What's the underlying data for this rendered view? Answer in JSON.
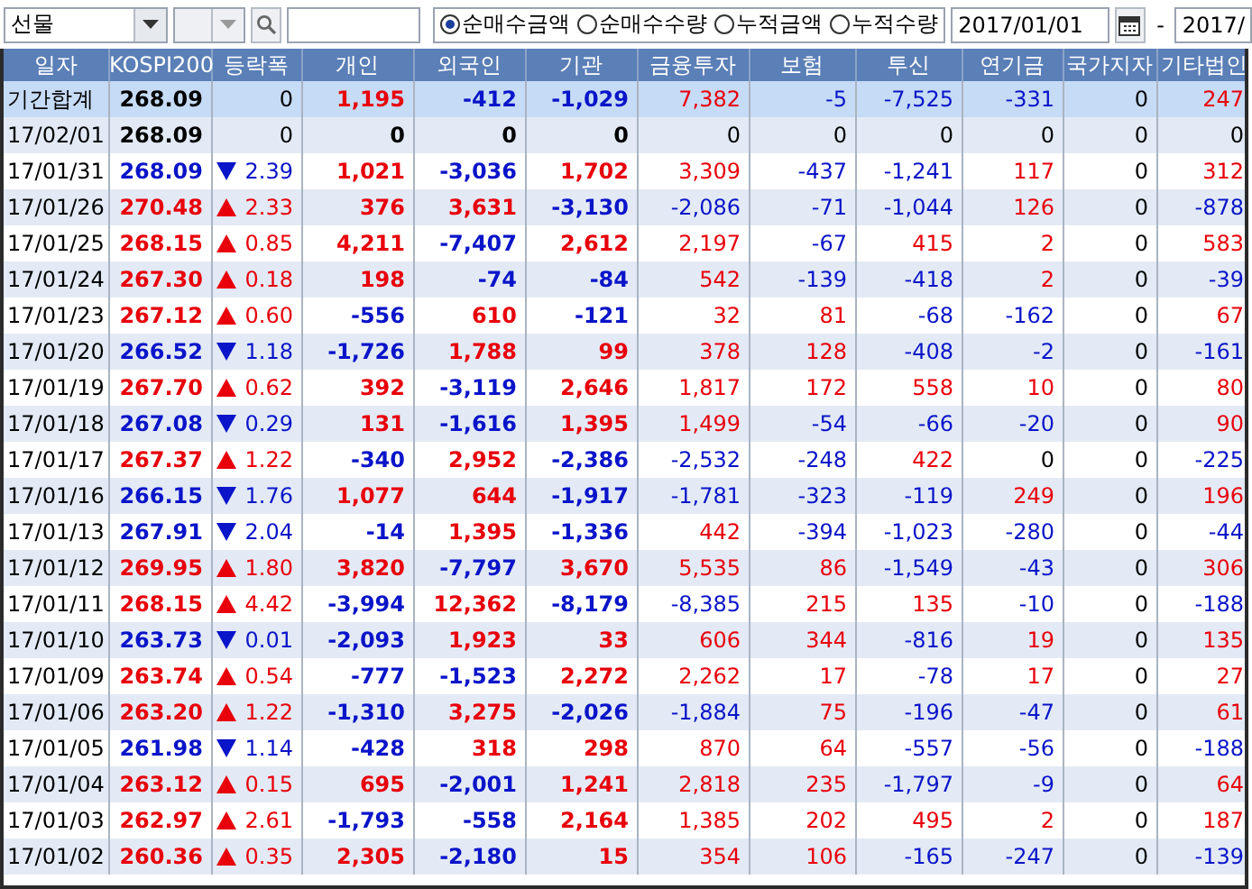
{
  "toolbar": {
    "market_select": {
      "value": "선물"
    },
    "code_select": {
      "disabled": true
    },
    "radio_options": [
      {
        "label": "순매수금액",
        "selected": true
      },
      {
        "label": "순매수수량",
        "selected": false
      },
      {
        "label": "누적금액",
        "selected": false
      },
      {
        "label": "누적수량",
        "selected": false
      }
    ],
    "date_from": "2017/01/01",
    "date_separator": "-",
    "date_to": "2017/"
  },
  "table": {
    "columns": [
      "일자",
      "KOSPI200",
      "등락폭",
      "개인",
      "외국인",
      "기관",
      "금융투자",
      "보험",
      "투신",
      "연기금",
      "국가지자",
      "기타법인"
    ],
    "rows": [
      {
        "kind": "summary",
        "date": "기간합계",
        "kospi": "268.09",
        "up": false,
        "down": false,
        "change": "0",
        "values": [
          "1,195",
          "-412",
          "-1,029",
          "7,382",
          "-5",
          "-7,525",
          "-331",
          "0",
          "247"
        ]
      },
      {
        "kind": "day",
        "date": "17/02/01",
        "kospi": "268.09",
        "up": false,
        "down": false,
        "change": "0",
        "values": [
          "0",
          "0",
          "0",
          "0",
          "0",
          "0",
          "0",
          "0",
          "0"
        ]
      },
      {
        "kind": "day",
        "date": "17/01/31",
        "kospi": "268.09",
        "up": false,
        "down": true,
        "change": "2.39",
        "values": [
          "1,021",
          "-3,036",
          "1,702",
          "3,309",
          "-437",
          "-1,241",
          "117",
          "0",
          "312"
        ]
      },
      {
        "kind": "day",
        "date": "17/01/26",
        "kospi": "270.48",
        "up": true,
        "down": false,
        "change": "2.33",
        "values": [
          "376",
          "3,631",
          "-3,130",
          "-2,086",
          "-71",
          "-1,044",
          "126",
          "0",
          "-878"
        ]
      },
      {
        "kind": "day",
        "date": "17/01/25",
        "kospi": "268.15",
        "up": true,
        "down": false,
        "change": "0.85",
        "values": [
          "4,211",
          "-7,407",
          "2,612",
          "2,197",
          "-67",
          "415",
          "2",
          "0",
          "583"
        ]
      },
      {
        "kind": "day",
        "date": "17/01/24",
        "kospi": "267.30",
        "up": true,
        "down": false,
        "change": "0.18",
        "values": [
          "198",
          "-74",
          "-84",
          "542",
          "-139",
          "-418",
          "2",
          "0",
          "-39"
        ]
      },
      {
        "kind": "day",
        "date": "17/01/23",
        "kospi": "267.12",
        "up": true,
        "down": false,
        "change": "0.60",
        "values": [
          "-556",
          "610",
          "-121",
          "32",
          "81",
          "-68",
          "-162",
          "0",
          "67"
        ]
      },
      {
        "kind": "day",
        "date": "17/01/20",
        "kospi": "266.52",
        "up": false,
        "down": true,
        "change": "1.18",
        "values": [
          "-1,726",
          "1,788",
          "99",
          "378",
          "128",
          "-408",
          "-2",
          "0",
          "-161"
        ]
      },
      {
        "kind": "day",
        "date": "17/01/19",
        "kospi": "267.70",
        "up": true,
        "down": false,
        "change": "0.62",
        "values": [
          "392",
          "-3,119",
          "2,646",
          "1,817",
          "172",
          "558",
          "10",
          "0",
          "80"
        ]
      },
      {
        "kind": "day",
        "date": "17/01/18",
        "kospi": "267.08",
        "up": false,
        "down": true,
        "change": "0.29",
        "values": [
          "131",
          "-1,616",
          "1,395",
          "1,499",
          "-54",
          "-66",
          "-20",
          "0",
          "90"
        ]
      },
      {
        "kind": "day",
        "date": "17/01/17",
        "kospi": "267.37",
        "up": true,
        "down": false,
        "change": "1.22",
        "values": [
          "-340",
          "2,952",
          "-2,386",
          "-2,532",
          "-248",
          "422",
          "0",
          "0",
          "-225"
        ]
      },
      {
        "kind": "day",
        "date": "17/01/16",
        "kospi": "266.15",
        "up": false,
        "down": true,
        "change": "1.76",
        "values": [
          "1,077",
          "644",
          "-1,917",
          "-1,781",
          "-323",
          "-119",
          "249",
          "0",
          "196"
        ]
      },
      {
        "kind": "day",
        "date": "17/01/13",
        "kospi": "267.91",
        "up": false,
        "down": true,
        "change": "2.04",
        "values": [
          "-14",
          "1,395",
          "-1,336",
          "442",
          "-394",
          "-1,023",
          "-280",
          "0",
          "-44"
        ]
      },
      {
        "kind": "day",
        "date": "17/01/12",
        "kospi": "269.95",
        "up": true,
        "down": false,
        "change": "1.80",
        "values": [
          "3,820",
          "-7,797",
          "3,670",
          "5,535",
          "86",
          "-1,549",
          "-43",
          "0",
          "306"
        ]
      },
      {
        "kind": "day",
        "date": "17/01/11",
        "kospi": "268.15",
        "up": true,
        "down": false,
        "change": "4.42",
        "values": [
          "-3,994",
          "12,362",
          "-8,179",
          "-8,385",
          "215",
          "135",
          "-10",
          "0",
          "-188"
        ]
      },
      {
        "kind": "day",
        "date": "17/01/10",
        "kospi": "263.73",
        "up": false,
        "down": true,
        "change": "0.01",
        "values": [
          "-2,093",
          "1,923",
          "33",
          "606",
          "344",
          "-816",
          "19",
          "0",
          "135"
        ]
      },
      {
        "kind": "day",
        "date": "17/01/09",
        "kospi": "263.74",
        "up": true,
        "down": false,
        "change": "0.54",
        "values": [
          "-777",
          "-1,523",
          "2,272",
          "2,262",
          "17",
          "-78",
          "17",
          "0",
          "27"
        ]
      },
      {
        "kind": "day",
        "date": "17/01/06",
        "kospi": "263.20",
        "up": true,
        "down": false,
        "change": "1.22",
        "values": [
          "-1,310",
          "3,275",
          "-2,026",
          "-1,884",
          "75",
          "-196",
          "-47",
          "0",
          "61"
        ]
      },
      {
        "kind": "day",
        "date": "17/01/05",
        "kospi": "261.98",
        "up": false,
        "down": true,
        "change": "1.14",
        "values": [
          "-428",
          "318",
          "298",
          "870",
          "64",
          "-557",
          "-56",
          "0",
          "-188"
        ]
      },
      {
        "kind": "day",
        "date": "17/01/04",
        "kospi": "263.12",
        "up": true,
        "down": false,
        "change": "0.15",
        "values": [
          "695",
          "-2,001",
          "1,241",
          "2,818",
          "235",
          "-1,797",
          "-9",
          "0",
          "64"
        ]
      },
      {
        "kind": "day",
        "date": "17/01/03",
        "kospi": "262.97",
        "up": true,
        "down": false,
        "change": "2.61",
        "values": [
          "-1,793",
          "-558",
          "2,164",
          "1,385",
          "202",
          "495",
          "2",
          "0",
          "187"
        ]
      },
      {
        "kind": "day",
        "date": "17/01/02",
        "kospi": "260.36",
        "up": true,
        "down": false,
        "change": "0.35",
        "values": [
          "2,305",
          "-2,180",
          "15",
          "354",
          "106",
          "-165",
          "-247",
          "0",
          "-139"
        ]
      }
    ]
  }
}
